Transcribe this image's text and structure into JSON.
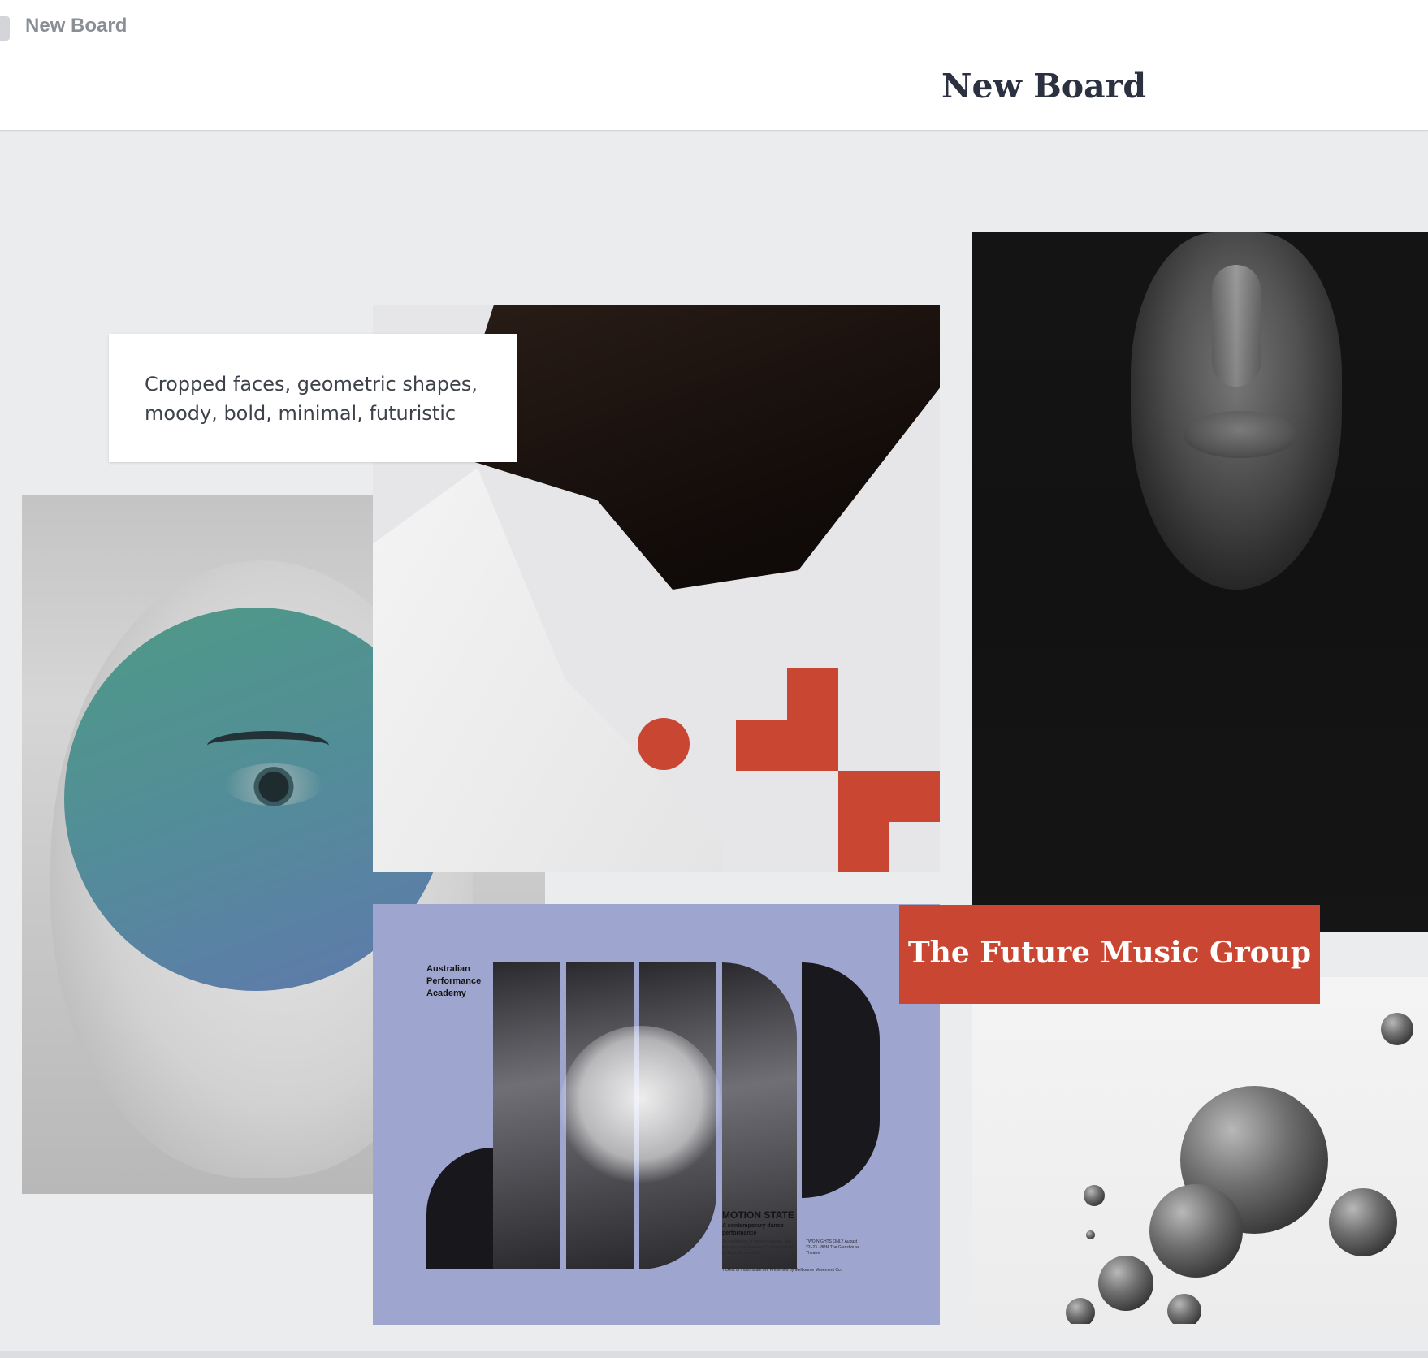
{
  "tab": {
    "title": "New Board"
  },
  "header": {
    "board_title": "New Board"
  },
  "note": {
    "text": "Cropped faces, geometric shapes, moody, bold, minimal, futuristic"
  },
  "label": {
    "text": "The Future Music Group"
  },
  "poster": {
    "header": "Australian\nPerformance\nAcademy",
    "title": "MOTION STATE",
    "subtitle": "A contemporary dance performance",
    "description": "An exploration of tension, release, and the spaces in between. Choreographed by Elise Roman & Co.",
    "dates": "TWO NIGHTS ONLY August 22–23 · 8PM The Glasshouse Theatre",
    "footer": "Tickets at motionstate.live Presented by Melbourne Movement Co."
  },
  "colors": {
    "accent_red": "#c94633",
    "poster_blue": "#9ea6cf",
    "canvas_bg": "#ebecee"
  },
  "cards": [
    {
      "kind": "image",
      "subject": "eye-portrait-with-teal-circle"
    },
    {
      "kind": "image",
      "subject": "neck-with-red-geometric-shapes"
    },
    {
      "kind": "image",
      "subject": "hooded-woman-black-and-white"
    },
    {
      "kind": "image",
      "subject": "dance-poster"
    },
    {
      "kind": "image",
      "subject": "floating-spheres"
    }
  ]
}
